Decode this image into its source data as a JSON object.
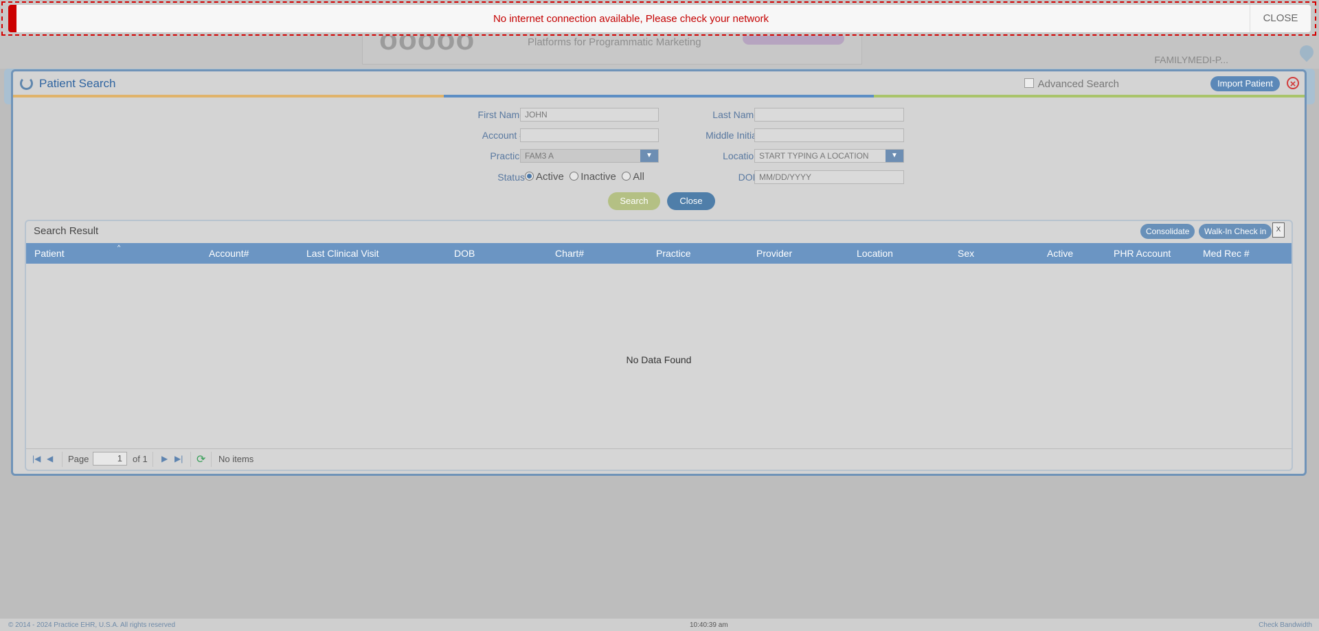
{
  "alert": {
    "message": "No internet connection available, Please check your network",
    "close_label": "CLOSE"
  },
  "background": {
    "ad_text": "Platforms for Programmatic Marketing",
    "user_label": "FAMILYMEDI-P..."
  },
  "modal": {
    "title": "Patient Search",
    "advanced_search_label": "Advanced Search",
    "import_button": "Import Patient",
    "close_icon": "close-circle-icon",
    "color_bar": [
      "#e0b36a",
      "#5d8ec4",
      "#a9c46a"
    ]
  },
  "form": {
    "first_name": {
      "label": "First Name",
      "value": "JOHN"
    },
    "last_name": {
      "label": "Last Name",
      "value": ""
    },
    "account": {
      "label": "Account #",
      "value": ""
    },
    "middle_initial": {
      "label": "Middle Initial",
      "value": ""
    },
    "practice": {
      "label": "Practice",
      "value": "FAM3 A"
    },
    "location": {
      "label": "Location",
      "placeholder": "START TYPING A LOCATION"
    },
    "status": {
      "label": "Status",
      "options": [
        "Active",
        "Inactive",
        "All"
      ],
      "selected": "Active"
    },
    "dob": {
      "label": "DOB",
      "placeholder": "MM/DD/YYYY"
    },
    "search_button": "Search",
    "close_button": "Close"
  },
  "results": {
    "title": "Search Result",
    "consolidate_button": "Consolidate",
    "walkin_button": "Walk-In Check in",
    "columns": [
      "Patient",
      "Account#",
      "Last Clinical Visit",
      "DOB",
      "Chart#",
      "Practice",
      "Provider",
      "Location",
      "Sex",
      "Active",
      "PHR Account",
      "Med Rec #"
    ],
    "empty_text": "No Data Found",
    "pager": {
      "page_label": "Page",
      "page": "1",
      "of_label": "of 1",
      "items_text": "No items"
    }
  },
  "footer": {
    "copyright": "© 2014 - 2024 Practice EHR, U.S.A. All rights reserved",
    "time": "10:40:39 am",
    "bandwidth": "Check Bandwidth"
  },
  "colors": {
    "accent": "#5b88b8",
    "alert": "#cc0000",
    "header_row": "#6b95c3"
  }
}
